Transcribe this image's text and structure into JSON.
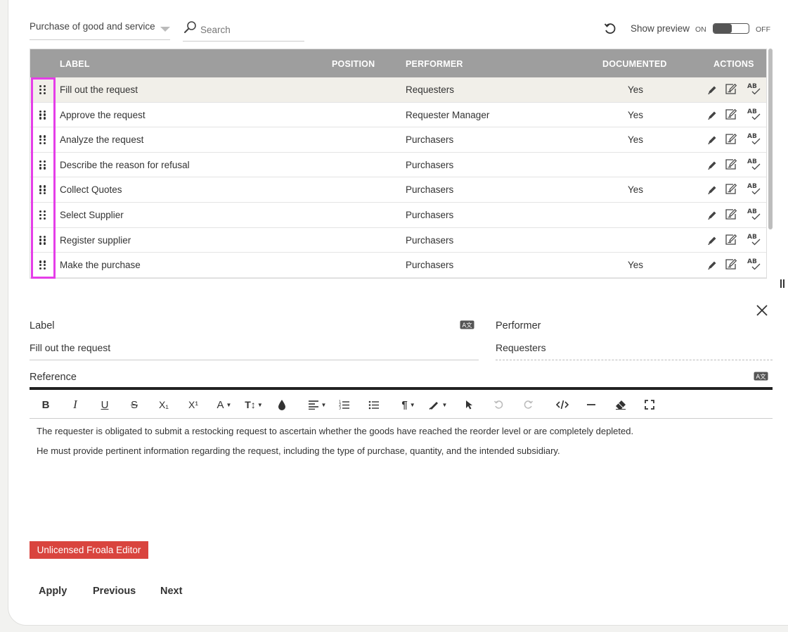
{
  "toolbar": {
    "process_select": "Purchase of good and service",
    "search_placeholder": "Search",
    "show_preview_label": "Show preview",
    "on_label": "ON",
    "off_label": "OFF"
  },
  "table": {
    "columns": {
      "label": "LABEL",
      "position": "POSITION",
      "performer": "PERFORMER",
      "documented": "DOCUMENTED",
      "actions": "ACTIONS"
    },
    "rows": [
      {
        "label": "Fill out the request",
        "performer": "Requesters",
        "documented": "Yes"
      },
      {
        "label": "Approve the request",
        "performer": "Requester Manager",
        "documented": "Yes"
      },
      {
        "label": "Analyze the request",
        "performer": "Purchasers",
        "documented": "Yes"
      },
      {
        "label": "Describe the reason for refusal",
        "performer": "Purchasers",
        "documented": ""
      },
      {
        "label": "Collect Quotes",
        "performer": "Purchasers",
        "documented": "Yes"
      },
      {
        "label": "Select Supplier",
        "performer": "Purchasers",
        "documented": ""
      },
      {
        "label": "Register supplier",
        "performer": "Purchasers",
        "documented": ""
      },
      {
        "label": "Make the purchase",
        "performer": "Purchasers",
        "documented": "Yes"
      }
    ],
    "spell_icon_text": "AB"
  },
  "form": {
    "label_title": "Label",
    "label_value": "Fill out the request",
    "performer_title": "Performer",
    "performer_value": "Requesters",
    "reference_title": "Reference",
    "translate_icon_text": "A文"
  },
  "editor": {
    "toolbar": {
      "bold": "B",
      "italic": "I",
      "underline": "U",
      "strike": "S",
      "subscript": "X₁",
      "superscript": "X¹",
      "font_family": "A",
      "font_size": "T↕",
      "paragraph": "¶"
    },
    "paragraphs": [
      "The requester is obligated to submit a restocking request to ascertain whether the goods have reached the reorder level or are completely depleted.",
      "He must provide pertinent information regarding the request, including the type of purchase, quantity, and the intended subsidiary."
    ],
    "unlicensed_label": "Unlicensed Froala Editor"
  },
  "buttons": {
    "apply": "Apply",
    "previous": "Previous",
    "next": "Next"
  },
  "colors": {
    "header_bg": "#9e9e9e",
    "selected_row": "#f1efe9",
    "highlight": "#e53ee8",
    "unlicensed_bg": "#d9443e"
  }
}
